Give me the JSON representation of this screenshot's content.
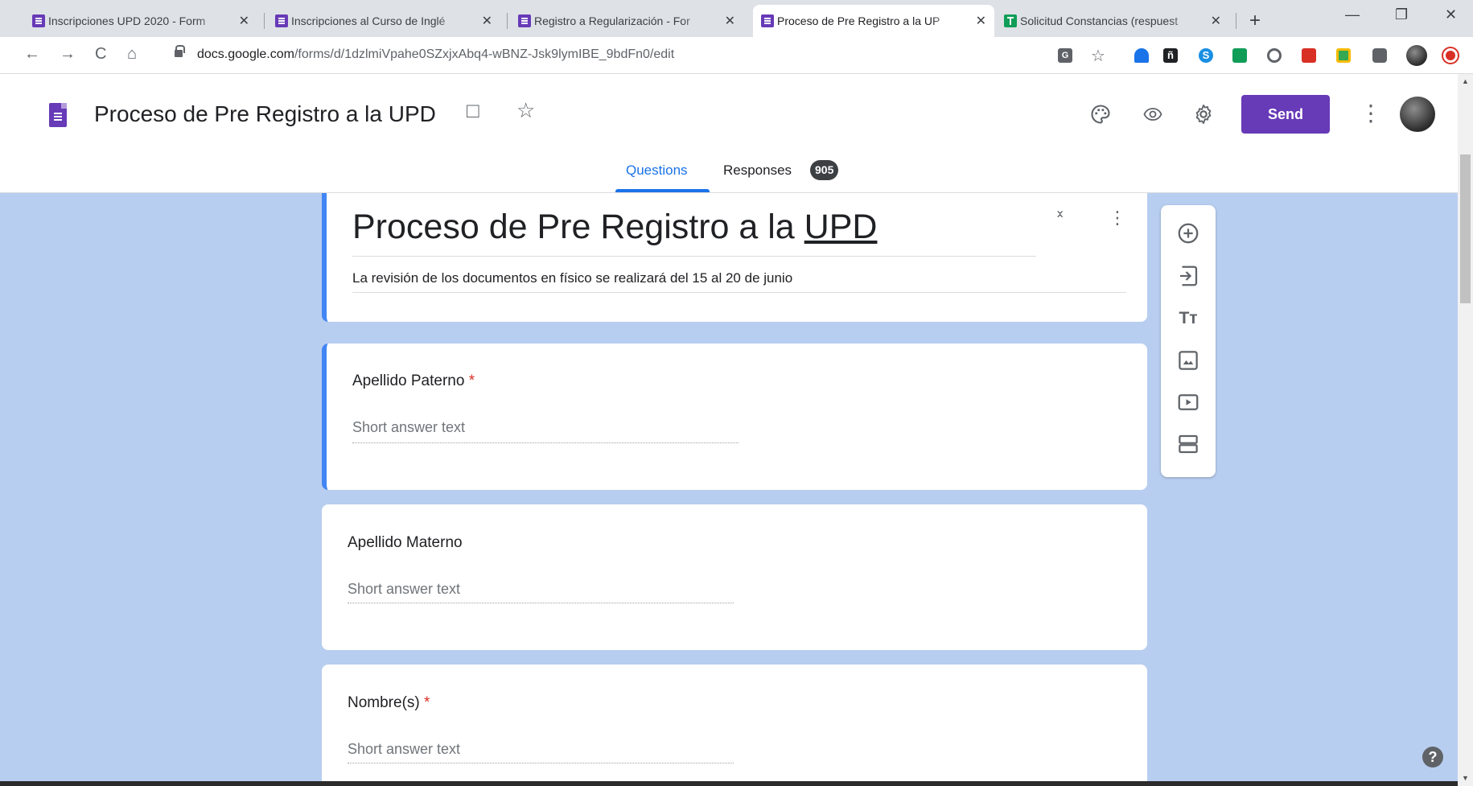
{
  "browser": {
    "tabs": [
      {
        "title": "Inscripciones UPD 2020 - Form",
        "close": "✕",
        "icon": "forms-purple"
      },
      {
        "title": "Inscripciones al Curso de Inglé",
        "close": "✕",
        "icon": "forms-purple"
      },
      {
        "title": "Registro a Regularización - For",
        "close": "✕",
        "icon": "forms-purple"
      },
      {
        "title": "Proceso de Pre Registro a la UP",
        "close": "✕",
        "icon": "forms-purple",
        "active": true
      },
      {
        "title": "Solicitud Constancias (respuest",
        "close": "✕",
        "icon": "sheets-green"
      }
    ],
    "new_tab": "+",
    "window_controls": {
      "minimize": "—",
      "restore": "❐",
      "close": "✕"
    },
    "nav": {
      "back": "←",
      "forward": "→",
      "reload": "C",
      "home": "⌂"
    },
    "url_host": "docs.google.com",
    "url_path": "/forms/d/1dzlmiVpahe0SZxjxAbq4-wBNZ-Jsk9lymIBE_9bdFn0/edit",
    "star": "☆",
    "extensions": [
      "translate-icon",
      "bookmark-icon",
      "ñ",
      "S",
      "cast-icon",
      "circle-icon",
      "pdf-icon",
      "classroom-icon",
      "puzzle-icon",
      "profile-icon",
      "opera-icon"
    ]
  },
  "header": {
    "doc_title": "Proceso de Pre Registro a la UPD",
    "folder_icon": "□",
    "star_icon": "☆",
    "send_label": "Send",
    "more_icon": "⋮",
    "tabs": {
      "questions": "Questions",
      "responses": "Responses",
      "responses_count": "905"
    }
  },
  "form": {
    "title_main": "Proceso de Pre Registro a la ",
    "title_tail": "UPD",
    "description": "La revisión de los documentos en físico se realizará del 15 al 20 de junio",
    "collapse_icon": "⌄⌃",
    "more_icon": "⋮",
    "questions": [
      {
        "label": "Apellido Paterno",
        "required": "*",
        "placeholder": "Short answer text"
      },
      {
        "label": "Apellido Materno",
        "required": "",
        "placeholder": "Short answer text"
      },
      {
        "label": "Nombre(s)",
        "required": "*",
        "placeholder": "Short answer text"
      }
    ]
  },
  "side_toolbar": [
    "add-question-icon",
    "import-questions-icon",
    "add-title-icon",
    "add-image-icon",
    "add-video-icon",
    "add-section-icon"
  ],
  "side_toolbar_labels": {
    "title_tool": "Tт"
  },
  "help": "?",
  "colors": {
    "brand": "#673ab7",
    "accent": "#1a73e8",
    "canvas": "#b8cef0",
    "required": "#d93025",
    "selected_border": "#4285f4"
  }
}
